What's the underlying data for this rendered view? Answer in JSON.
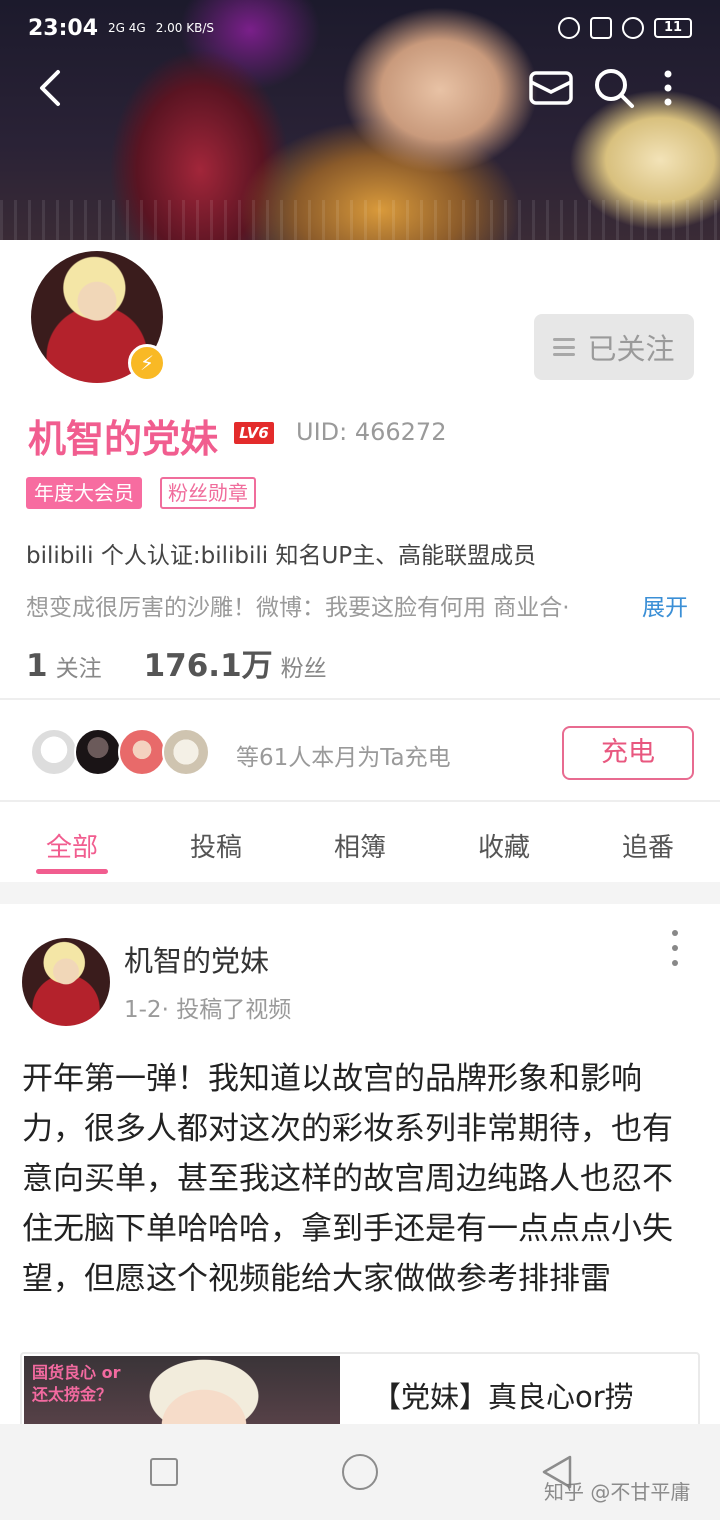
{
  "status_bar": {
    "time": "23:04",
    "network": "2G 4G",
    "speed": "2.00 KB/S",
    "battery": "11"
  },
  "header": {
    "icons": [
      "back-icon",
      "mail-icon",
      "search-icon",
      "more-vertical-icon"
    ]
  },
  "profile": {
    "follow_label": "已关注",
    "name": "机智的党妹",
    "level": "LV6",
    "uid": "UID: 466272",
    "vip_tag": "年度大会员",
    "fans_badge": "粉丝勋章",
    "certification": "bilibili 个人认证:bilibili 知名UP主、高能联盟成员",
    "bio": "想变成很厉害的沙雕！微博：我要这脸有何用 商业合·",
    "expand_label": "展开",
    "following_count": "1",
    "following_label": "关注",
    "fans_count": "176.1万",
    "fans_label": "粉丝"
  },
  "charge": {
    "text": "等61人本月为Ta充电",
    "button_label": "充电"
  },
  "tabs": [
    {
      "label": "全部",
      "active": true
    },
    {
      "label": "投稿",
      "active": false
    },
    {
      "label": "相簿",
      "active": false
    },
    {
      "label": "收藏",
      "active": false
    },
    {
      "label": "追番",
      "active": false
    }
  ],
  "post": {
    "author": "机智的党妹",
    "meta": "1-2· 投稿了视频",
    "text": "开年第一弹！我知道以故宫的品牌形象和影响力，很多人都对这次的彩妆系列非常期待，也有意向买单，甚至我这样的故宫周边纯路人也忍不住无脑下单哈哈哈，拿到手还是有一点点点小失望，但愿这个视频能给大家做做参考排排雷",
    "video_title": "【党妹】真良心or捞",
    "thumb_label": "国货良心 or 还太捞金？"
  },
  "watermark": "知乎 @不甘平庸",
  "colors": {
    "accent_pink": "#f15d8f",
    "link_blue": "#3b8fd6"
  }
}
